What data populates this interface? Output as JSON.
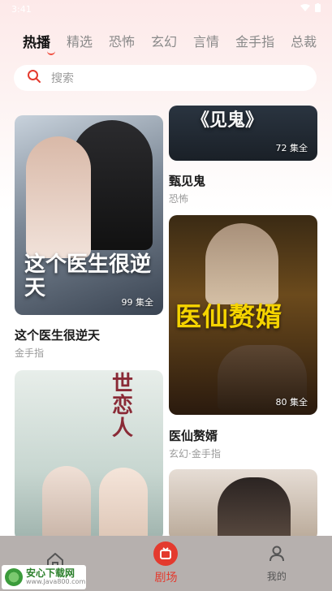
{
  "status_bar": {
    "time": "3:41",
    "signal": "▾",
    "battery": "▮"
  },
  "tabs": [
    {
      "label": "热播",
      "active": true
    },
    {
      "label": "精选",
      "active": false
    },
    {
      "label": "恐怖",
      "active": false
    },
    {
      "label": "玄幻",
      "active": false
    },
    {
      "label": "言情",
      "active": false
    },
    {
      "label": "金手指",
      "active": false
    },
    {
      "label": "总裁",
      "active": false
    }
  ],
  "search": {
    "placeholder": "搜索",
    "icon": "search-icon"
  },
  "dramas": [
    {
      "poster_title": "《见鬼》",
      "count": "72 集全",
      "title": "甄见鬼",
      "genre": "恐怖"
    },
    {
      "poster_title": "这个医生很逆天",
      "count": "99 集全",
      "title": "这个医生很逆天",
      "genre": "金手指"
    },
    {
      "poster_title": "医仙赘婿",
      "count": "80 集全",
      "title": "医仙赘婿",
      "genre": "玄幻·金手指"
    },
    {
      "poster_title": "世恋人",
      "count": "",
      "title": "",
      "genre": ""
    },
    {
      "poster_title": "",
      "count": "",
      "title": "",
      "genre": ""
    }
  ],
  "bottom_nav": [
    {
      "label": "",
      "icon": "home-icon",
      "active": false
    },
    {
      "label": "剧场",
      "icon": "theater-icon",
      "active": true
    },
    {
      "label": "我的",
      "icon": "profile-icon",
      "active": false
    }
  ],
  "watermark": {
    "name": "安心下载网",
    "url": "www.Java800.com"
  },
  "colors": {
    "accent": "#e43a2e",
    "nav_bg": "#b6b0ae"
  }
}
